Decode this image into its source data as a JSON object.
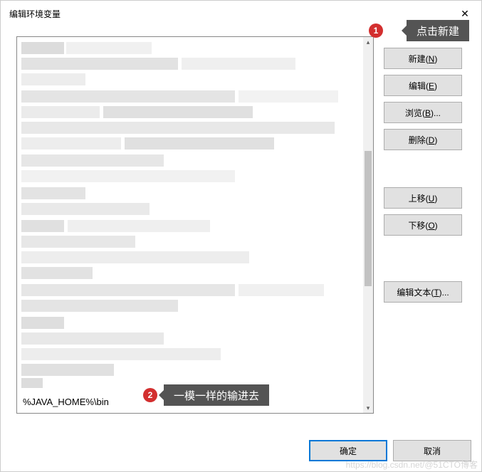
{
  "window": {
    "title": "编辑环境变量",
    "close": "✕"
  },
  "list": {
    "entry_value": "%JAVA_HOME%\\bin"
  },
  "buttons": {
    "new": "新建(N)",
    "edit": "编辑(E)",
    "browse": "浏览(B)...",
    "delete": "删除(D)",
    "moveup": "上移(U)",
    "movedown": "下移(O)",
    "edittext": "编辑文本(T)..."
  },
  "footer": {
    "ok": "确定",
    "cancel": "取消"
  },
  "annotations": {
    "badge1": "1",
    "callout1": "点击新建",
    "badge2": "2",
    "callout2": "一模一样的输进去"
  },
  "watermark": "https://blog.csdn.net/@51CTO博客"
}
